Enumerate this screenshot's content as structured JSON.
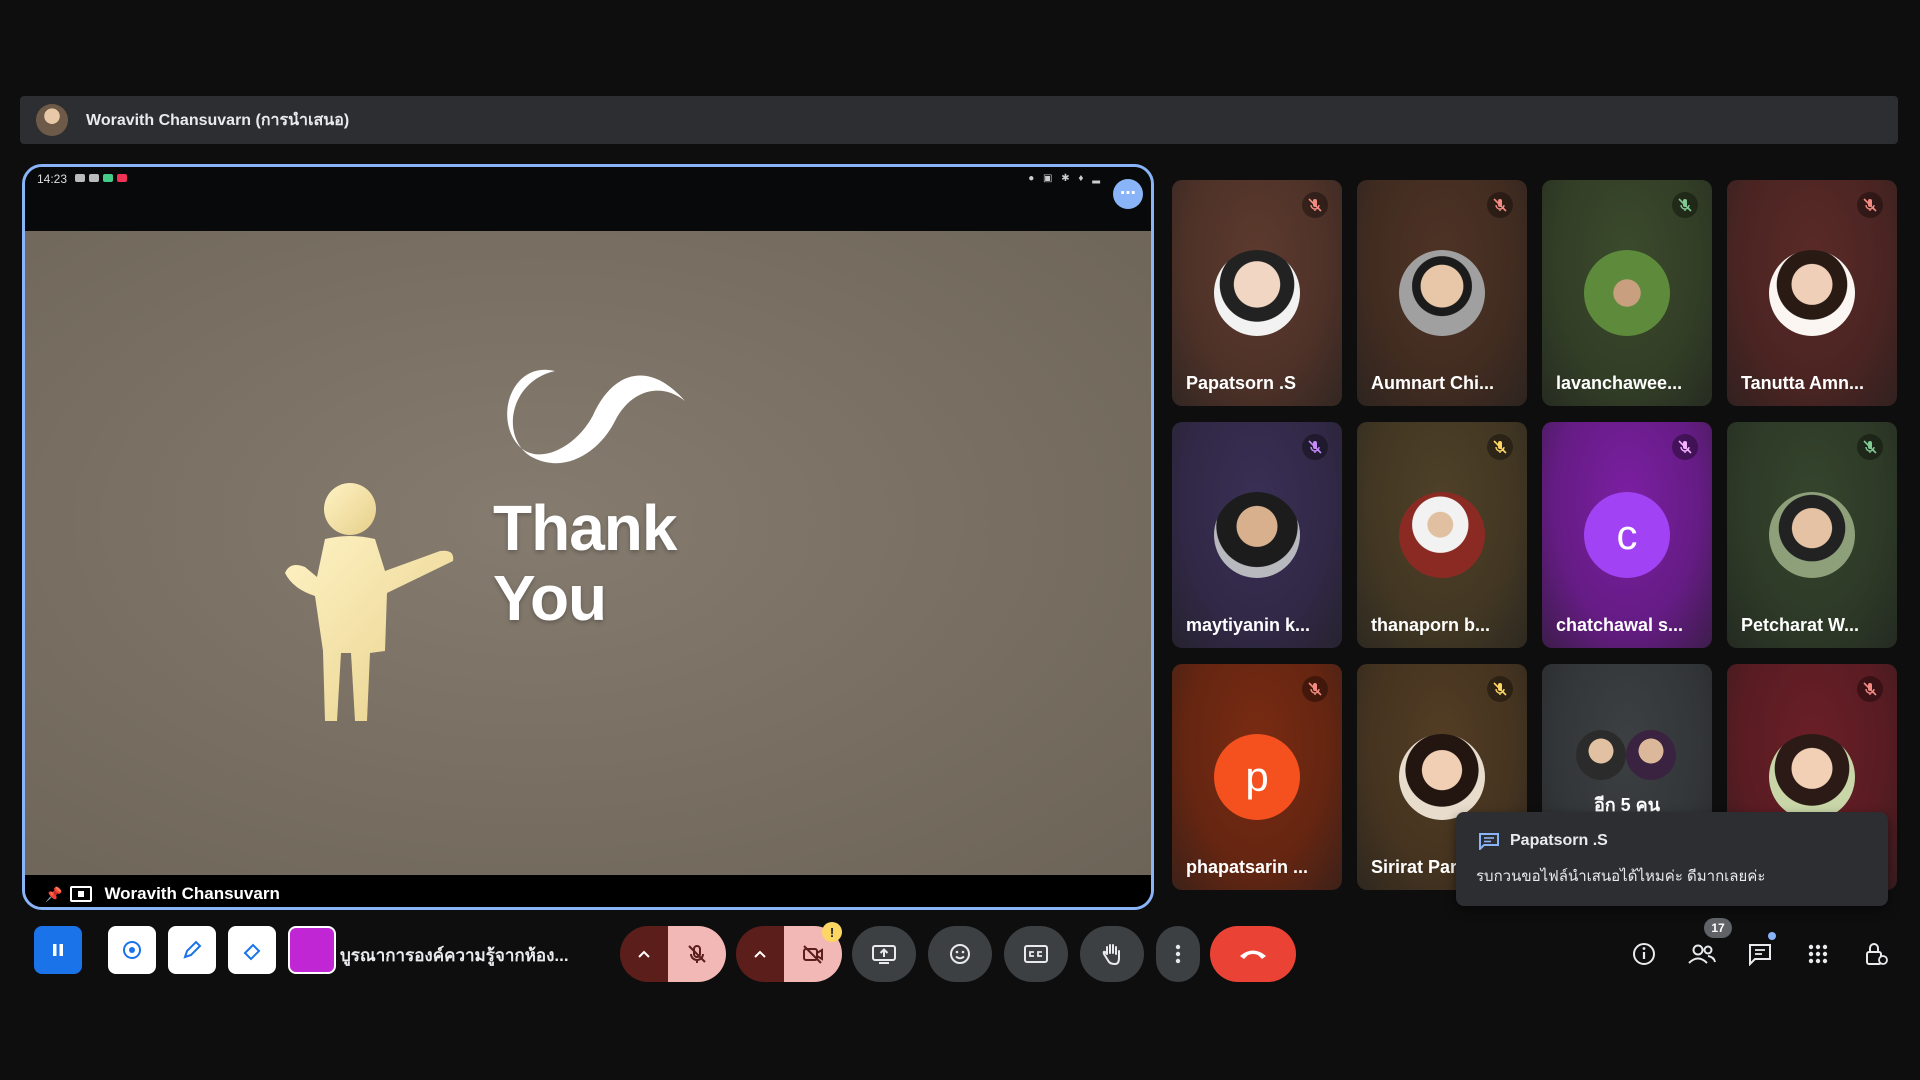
{
  "presentation_bar": {
    "title": "Woravith Chansuvarn (การนำเสนอ)"
  },
  "stage": {
    "status_time": "14:23",
    "slide": {
      "logo_icon": "infinity-logo-icon",
      "title_line1": "Thank",
      "title_line2": "You",
      "background": "#786e62"
    },
    "presenter_label": "Woravith Chansuvarn",
    "border_color": "#8ab4f8"
  },
  "tiles": [
    {
      "name": "Papatsorn .S",
      "bg": "#5d3a2e",
      "mute_color": "#f28b82"
    },
    {
      "name": "Aumnart Chi...",
      "bg": "#4e3325",
      "mute_color": "#f28b82"
    },
    {
      "name": "lavanchawee...",
      "bg": "#3b4a2c",
      "mute_color": "#81c995"
    },
    {
      "name": "Tanutta Amn...",
      "bg": "#5a2a27",
      "mute_color": "#f28b82"
    },
    {
      "name": "maytiyanin k...",
      "bg": "#3a2f55",
      "mute_color": "#c58af9"
    },
    {
      "name": "thanaporn b...",
      "bg": "#4f4128",
      "mute_color": "#fdd663"
    },
    {
      "name": "chatchawal s...",
      "bg": "#7b1fa2",
      "mute_color": "#f3b1ff",
      "letter": "c",
      "letter_bg": "#a142f4"
    },
    {
      "name": "Petcharat W...",
      "bg": "#35452d",
      "mute_color": "#81c995"
    },
    {
      "name": "phapatsarin ...",
      "bg": "#7a2b12",
      "mute_color": "#f28b82",
      "letter": "p",
      "letter_bg": "#f4511e"
    },
    {
      "name": "Sirirat Par",
      "bg": "#533d24",
      "mute_color": "#fdd663"
    },
    {
      "name": "อีก 5 คน",
      "bg": "#3c4043"
    },
    {
      "name": "",
      "bg": "#6b1f27",
      "mute_color": "#f28b82"
    }
  ],
  "toast": {
    "sender": "Papatsorn .S",
    "message": "รบกวนขอไฟล์นำเสนอได้ไหมค่ะ ดีมากเลยค่ะ"
  },
  "bottom_bar": {
    "meeting_title": "บูรณาการองค์ความรู้จากห้อง...",
    "annotation_tools": [
      {
        "icon": "pause-icon",
        "bg": "#1a73e8"
      },
      {
        "icon": "laser-pointer-icon",
        "bg": "#ffffff"
      },
      {
        "icon": "pen-icon",
        "bg": "#ffffff"
      },
      {
        "icon": "eraser-icon",
        "bg": "#ffffff"
      },
      {
        "icon": "color-swatch-icon",
        "bg": "#c026d3"
      }
    ],
    "controls": [
      "mic-options-chevron-icon",
      "mic-off-icon",
      "camera-options-chevron-icon",
      "camera-off-icon",
      "present-screen-icon",
      "emoji-icon",
      "captions-icon",
      "raise-hand-icon",
      "more-options-icon",
      "hang-up-icon"
    ],
    "right_icons": [
      "info-icon",
      "people-icon",
      "chat-icon",
      "activities-icon",
      "host-controls-icon"
    ],
    "participant_count": "17",
    "warning_mark": "!"
  }
}
